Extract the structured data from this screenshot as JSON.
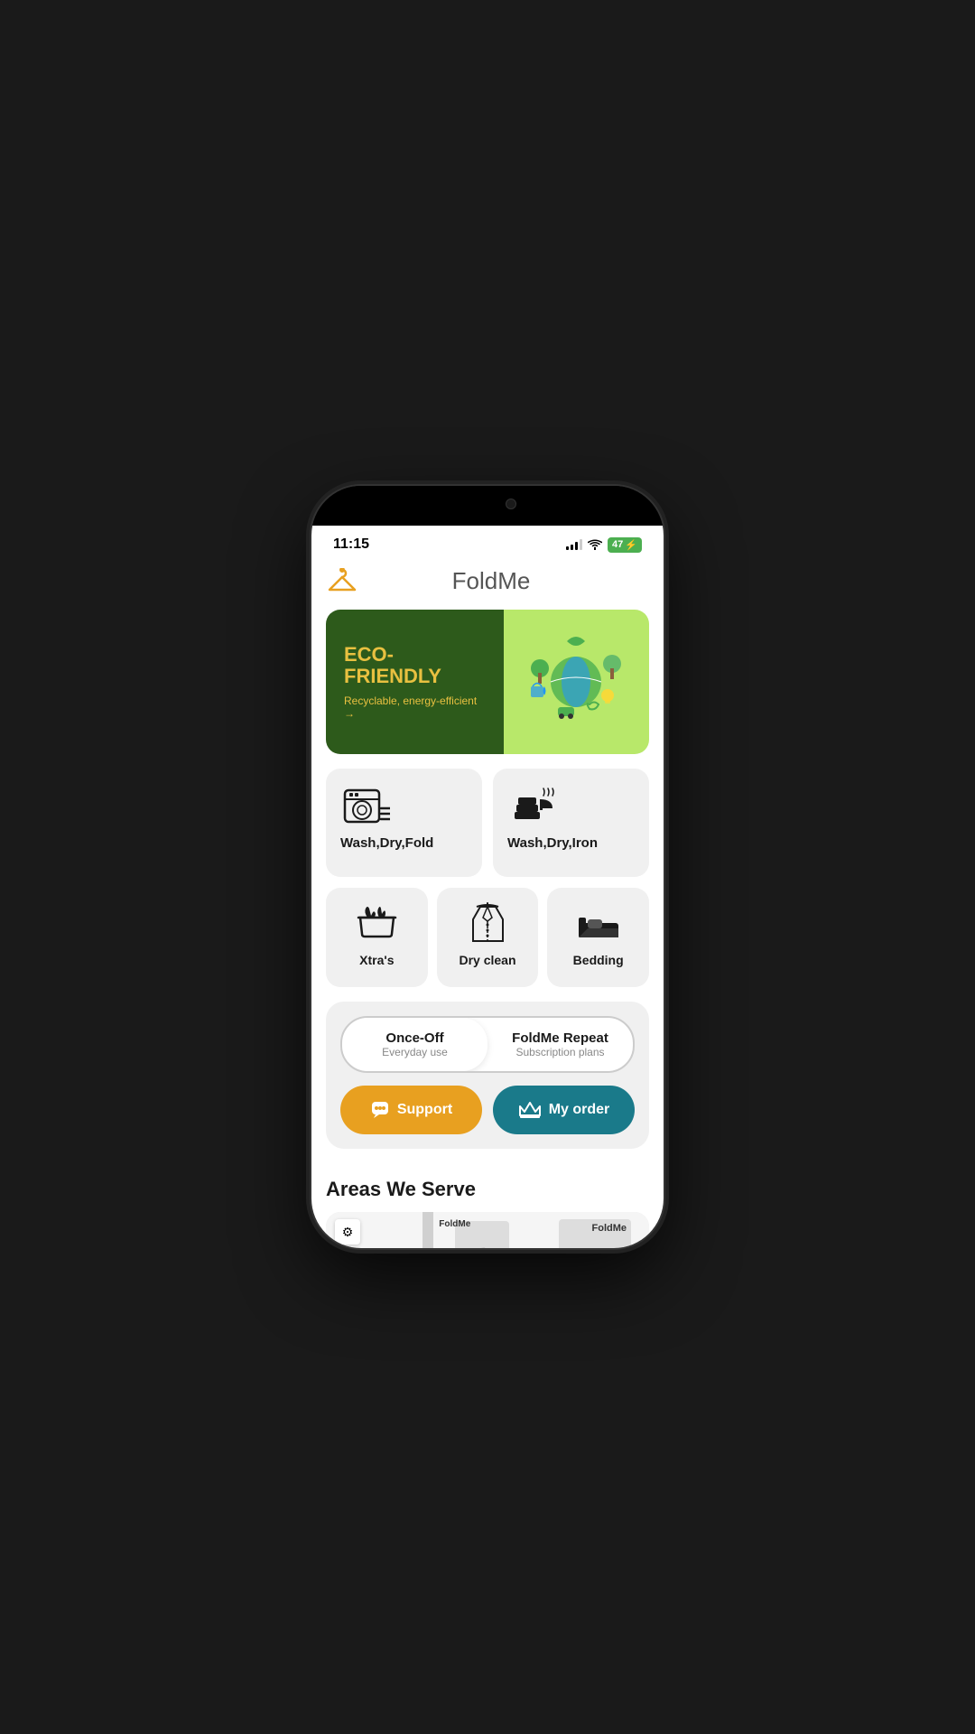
{
  "status": {
    "time": "11:15",
    "battery_level": "47",
    "battery_charging": true
  },
  "header": {
    "app_name": "FoldMe",
    "hanger_icon": "🧥"
  },
  "eco_banner": {
    "title": "ECO-FRIENDLY",
    "subtitle": "Recyclable, energy-efficient →",
    "arrow": "→"
  },
  "services_row1": [
    {
      "id": "wash-dry-fold",
      "label": "Wash,Dry,Fold"
    },
    {
      "id": "wash-dry-iron",
      "label": "Wash,Dry,Iron"
    }
  ],
  "services_row2": [
    {
      "id": "xtras",
      "label": "Xtra's"
    },
    {
      "id": "dry-clean",
      "label": "Dry clean"
    },
    {
      "id": "bedding",
      "label": "Bedding"
    }
  ],
  "toggle": {
    "option1_primary": "Once-Off",
    "option1_secondary": "Everyday use",
    "option2_primary": "FoldMe Repeat",
    "option2_secondary": "Subscription plans"
  },
  "buttons": {
    "support_label": "Support",
    "order_label": "My order"
  },
  "areas": {
    "section_title": "Areas We Serve",
    "map_label1": "FoldMe",
    "map_label2": "FoldMe"
  },
  "colors": {
    "eco_dark_green": "#2d5a1b",
    "eco_light_green": "#b8e86a",
    "eco_yellow": "#E8C040",
    "support_orange": "#E8A020",
    "order_teal": "#1a7a8a",
    "card_bg": "#f0f0f0"
  }
}
